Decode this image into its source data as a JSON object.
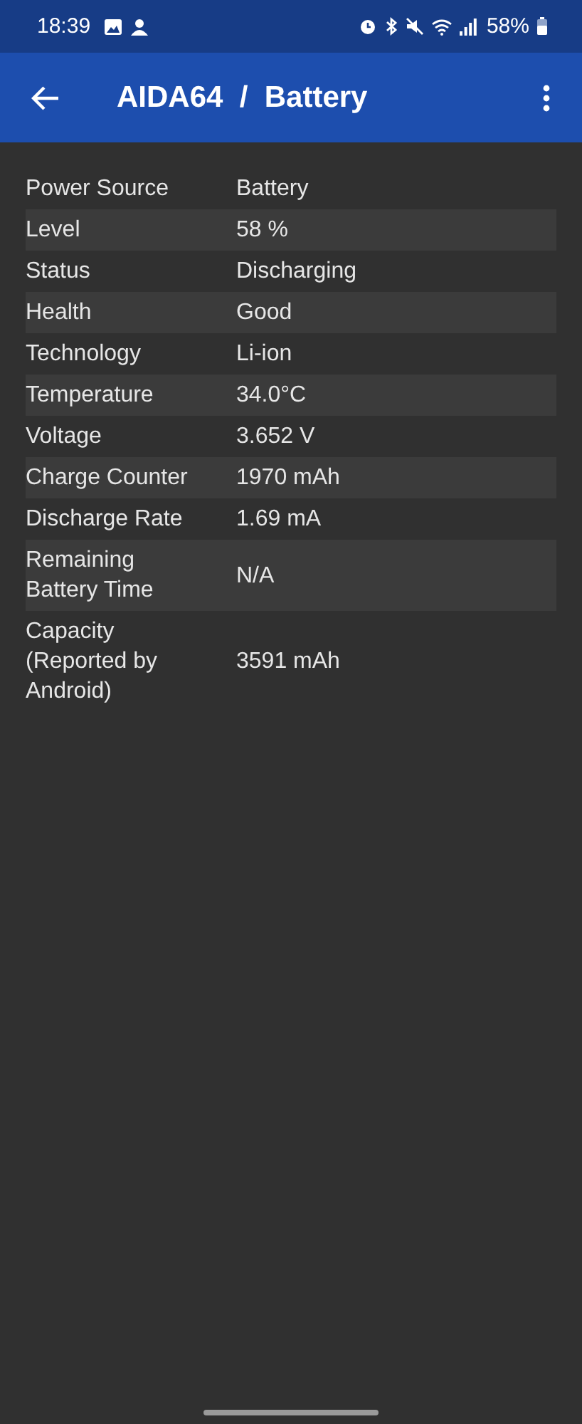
{
  "status_bar": {
    "time": "18:39",
    "battery": "58%"
  },
  "app_bar": {
    "title": "AIDA64  /  Battery"
  },
  "rows": [
    {
      "label": "Power Source",
      "value": "Battery"
    },
    {
      "label": "Level",
      "value": "58 %"
    },
    {
      "label": "Status",
      "value": "Discharging"
    },
    {
      "label": "Health",
      "value": "Good"
    },
    {
      "label": "Technology",
      "value": "Li-ion"
    },
    {
      "label": "Temperature",
      "value": "34.0°C"
    },
    {
      "label": "Voltage",
      "value": "3.652 V"
    },
    {
      "label": "Charge Counter",
      "value": "1970 mAh"
    },
    {
      "label": "Discharge Rate",
      "value": "1.69 mA"
    },
    {
      "label": "Remaining Battery Time",
      "value": "N/A"
    },
    {
      "label": "Capacity (Reported by Android)",
      "value": "3591 mAh"
    }
  ]
}
